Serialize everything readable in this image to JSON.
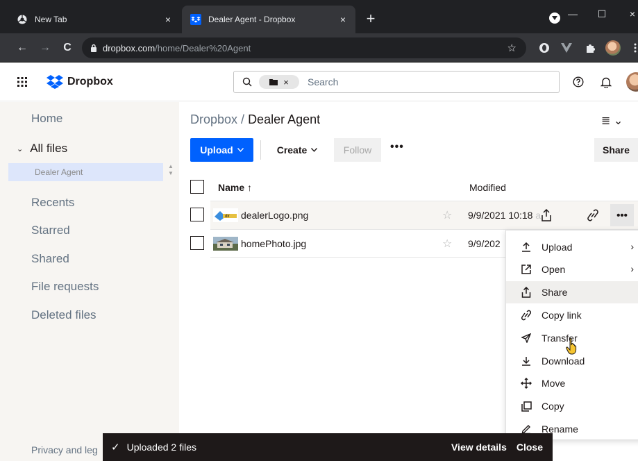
{
  "browser": {
    "tabs": [
      {
        "label": "New Tab",
        "close": "×"
      },
      {
        "label": "Dealer Agent - Dropbox",
        "close": "×"
      }
    ],
    "new_tab": "+",
    "window": {
      "minimize": "—",
      "maximize": "☐",
      "close": "×"
    },
    "nav": {
      "back": "←",
      "forward": "→",
      "reload": "C"
    },
    "url_host": "dropbox.com",
    "url_path": "/home/Dealer%20Agent",
    "bookmark_star": "☆"
  },
  "header": {
    "logo_text": "Dropbox",
    "search_placeholder": "Search",
    "chip_close": "×",
    "brand_color": "#0061fe"
  },
  "sidebar": {
    "home": "Home",
    "all_files": "All files",
    "all_files_chevron": "⌄",
    "selected_folder": "Dealer Agent",
    "items": [
      "Recents",
      "Starred",
      "Shared",
      "File requests",
      "Deleted files"
    ],
    "footer": "Privacy and leg"
  },
  "main": {
    "breadcrumb_root": "Dropbox",
    "breadcrumb_sep": " / ",
    "breadcrumb_current": "Dealer Agent",
    "view_toggle": "≣ ⌄",
    "upload": "Upload",
    "create": "Create",
    "follow": "Follow",
    "more": "•••",
    "share": "Share",
    "col_name": "Name ↑",
    "col_modified": "Modified",
    "files": [
      {
        "name": "dealerLogo.png",
        "modified": "9/9/2021 10:18",
        "modified_fade": " a"
      },
      {
        "name": "homePhoto.jpg",
        "modified": "9/9/202",
        "modified_fade": ""
      }
    ]
  },
  "menu": {
    "items": [
      {
        "label": "Upload",
        "icon": "upload-icon",
        "submenu": "›"
      },
      {
        "label": "Open",
        "icon": "open-external-icon",
        "submenu": "›"
      },
      {
        "label": "Share",
        "icon": "share-icon",
        "submenu": ""
      },
      {
        "label": "Copy link",
        "icon": "link-icon",
        "submenu": ""
      },
      {
        "label": "Transfer",
        "icon": "send-icon",
        "submenu": ""
      },
      {
        "label": "Download",
        "icon": "download-icon",
        "submenu": ""
      },
      {
        "label": "Move",
        "icon": "move-icon",
        "submenu": ""
      },
      {
        "label": "Copy",
        "icon": "copy-icon",
        "submenu": ""
      },
      {
        "label": "Rename",
        "icon": "pencil-icon",
        "submenu": ""
      }
    ]
  },
  "snackbar": {
    "check": "✓",
    "message": "Uploaded 2 files",
    "view_details": "View details",
    "close": "Close"
  }
}
